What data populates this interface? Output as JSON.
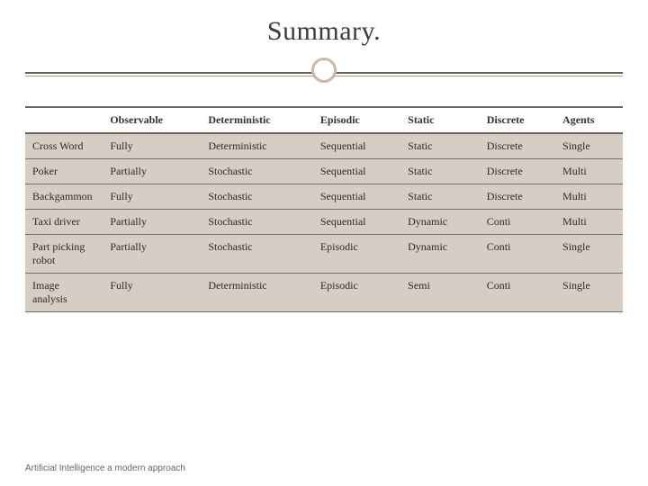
{
  "title": "Summary.",
  "footer": "Artificial Intelligence a modern approach",
  "table": {
    "headers": [
      "",
      "Observable",
      "Deterministic",
      "Episodic",
      "Static",
      "Discrete",
      "Agents"
    ],
    "rows": [
      [
        "Cross Word",
        "Fully",
        "Deterministic",
        "Sequential",
        "Static",
        "Discrete",
        "Single"
      ],
      [
        "Poker",
        "Partially",
        "Stochastic",
        "Sequential",
        "Static",
        "Discrete",
        "Multi"
      ],
      [
        "Backgammon",
        "Fully",
        "Stochastic",
        "Sequential",
        "Static",
        "Discrete",
        "Multi"
      ],
      [
        "Taxi driver",
        "Partially",
        "Stochastic",
        "Sequential",
        "Dynamic",
        "Conti",
        "Multi"
      ],
      [
        "Part picking robot",
        "Partially",
        "Stochastic",
        "Episodic",
        "Dynamic",
        "Conti",
        "Single"
      ],
      [
        "Image analysis",
        "Fully",
        "Deterministic",
        "Episodic",
        "Semi",
        "Conti",
        "Single"
      ]
    ]
  }
}
